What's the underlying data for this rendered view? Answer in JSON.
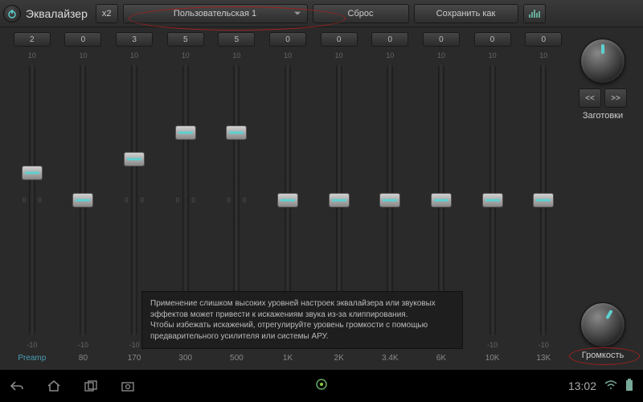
{
  "header": {
    "title": "Эквалайзер",
    "multiplier": "x2",
    "preset": "Пользовательская 1",
    "reset": "Сброс",
    "save_as": "Сохранить как"
  },
  "scale": {
    "max": "10",
    "min": "-10",
    "mid": "0"
  },
  "sliders": [
    {
      "value": "2",
      "label": "Preamp",
      "pos": 40,
      "preamp": true
    },
    {
      "value": "0",
      "label": "80",
      "pos": 50
    },
    {
      "value": "3",
      "label": "170",
      "pos": 35
    },
    {
      "value": "5",
      "label": "300",
      "pos": 25
    },
    {
      "value": "5",
      "label": "500",
      "pos": 25
    },
    {
      "value": "0",
      "label": "1K",
      "pos": 50
    },
    {
      "value": "0",
      "label": "2K",
      "pos": 50
    },
    {
      "value": "0",
      "label": "3.4K",
      "pos": 50
    },
    {
      "value": "0",
      "label": "6K",
      "pos": 50
    },
    {
      "value": "0",
      "label": "10K",
      "pos": 50
    },
    {
      "value": "0",
      "label": "13K",
      "pos": 50
    }
  ],
  "right": {
    "prev": "<<",
    "next": ">>",
    "presets_label": "Заготовки",
    "volume_label": "Громкость"
  },
  "tooltip": {
    "line1": "Применение слишком высоких уровней настроек эквалайзера или звуковых эффектов может привести к искажениям звука из-за клиппирования.",
    "line2": "Чтобы избежать искажений, отрегулируйте уровень громкости с помощью предварительного усилителя или системы АРУ."
  },
  "sysbar": {
    "time": "13:02"
  }
}
